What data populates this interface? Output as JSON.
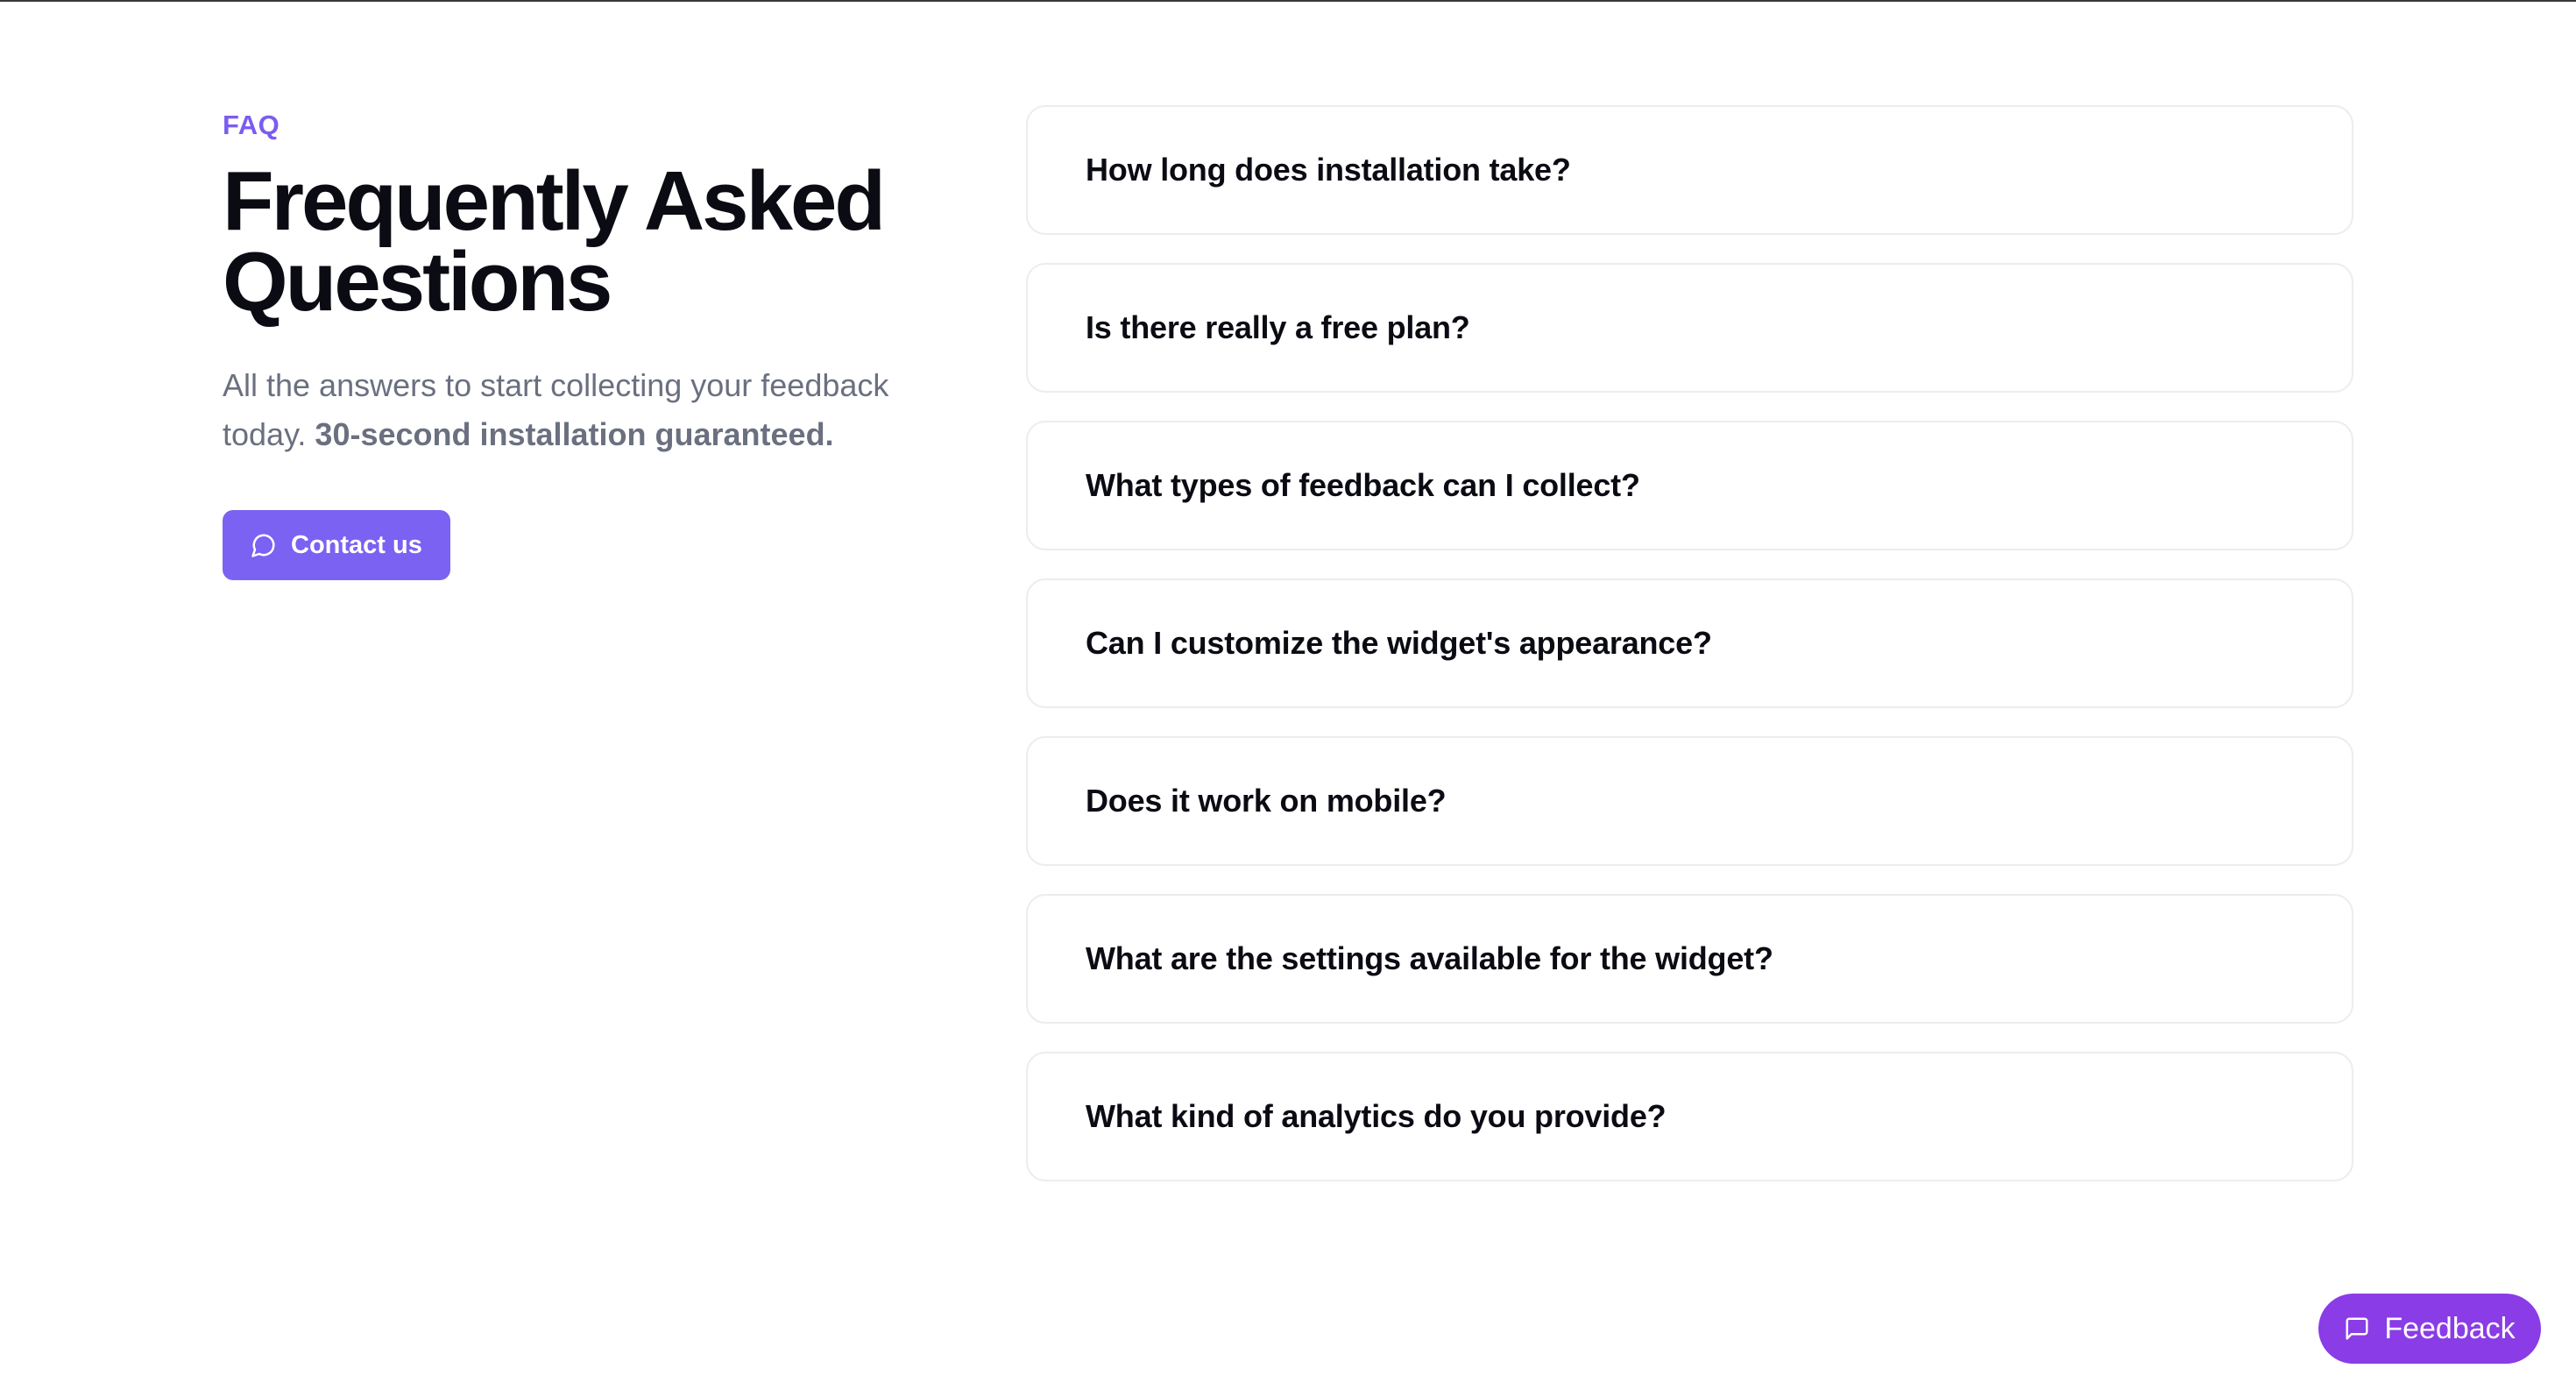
{
  "hero": {
    "eyebrow": "FAQ",
    "title": "Frequently Asked Questions",
    "subtitle_text": "All the answers to start collecting your feedback today.",
    "subtitle_strong": "30-second installation guaranteed.",
    "contact_label": "Contact us",
    "contact_icon": "chat-bubble-icon"
  },
  "faq": {
    "items": [
      {
        "question": "How long does installation take?"
      },
      {
        "question": "Is there really a free plan?"
      },
      {
        "question": "What types of feedback can I collect?"
      },
      {
        "question": "Can I customize the widget's appearance?"
      },
      {
        "question": "Does it work on mobile?"
      },
      {
        "question": "What are the settings available for the widget?"
      },
      {
        "question": "What kind of analytics do you provide?"
      }
    ]
  },
  "feedback_widget": {
    "label": "Feedback",
    "icon": "message-square-icon"
  },
  "colors": {
    "accent": "#7b62f2",
    "eyebrow": "#7b5cf0",
    "feedback_button": "#8a3ce6",
    "muted_text": "#6b7080",
    "card_border": "#ececf1"
  }
}
